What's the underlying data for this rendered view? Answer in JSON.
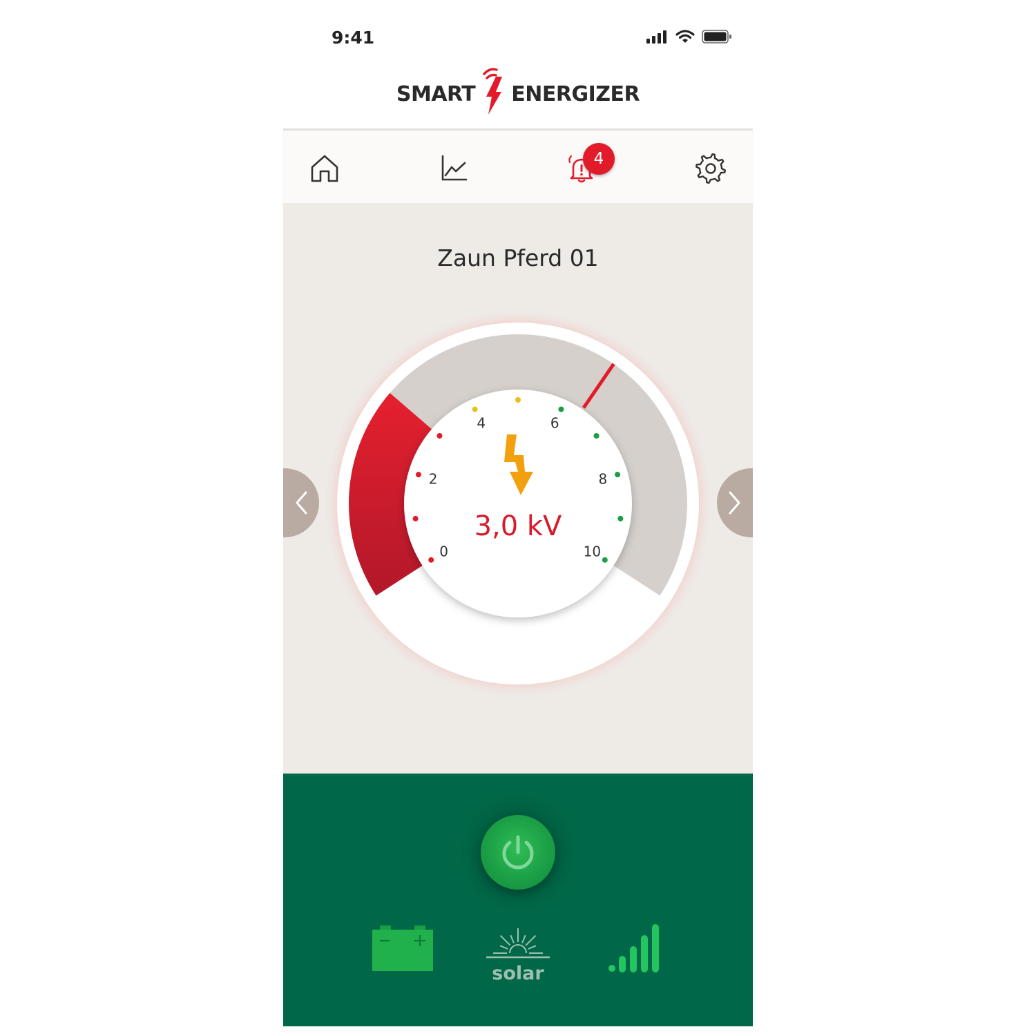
{
  "status_bar": {
    "time": "9:41"
  },
  "brand": {
    "left": "SMART",
    "right": "ENERGIZER",
    "color": "#e21b2b"
  },
  "nav": {
    "items": [
      {
        "name": "home",
        "icon": "home-icon"
      },
      {
        "name": "statistics",
        "icon": "line-chart-icon"
      },
      {
        "name": "alarms",
        "icon": "alarm-bell-icon",
        "badge": "4"
      },
      {
        "name": "settings",
        "icon": "gear-icon"
      }
    ]
  },
  "device": {
    "name": "Zaun Pferd 01"
  },
  "gauge": {
    "value_text": "3,0 kV",
    "value_kv": 3.0,
    "tick_labels": [
      "0",
      "2",
      "4",
      "6",
      "8",
      "10"
    ],
    "colors": {
      "active": "#e21b2b",
      "inactive": "#d5d0cc",
      "marker": "#e21b2b",
      "good": "#1a9d45",
      "warn": "#e6c01c"
    }
  },
  "bottom": {
    "power_icon": "power-icon",
    "battery_icon": "battery-icon",
    "solar_label": "solar",
    "signal_icon": "signal-strength-icon",
    "colors": {
      "panel": "#006848",
      "accent": "#22c55e"
    }
  }
}
